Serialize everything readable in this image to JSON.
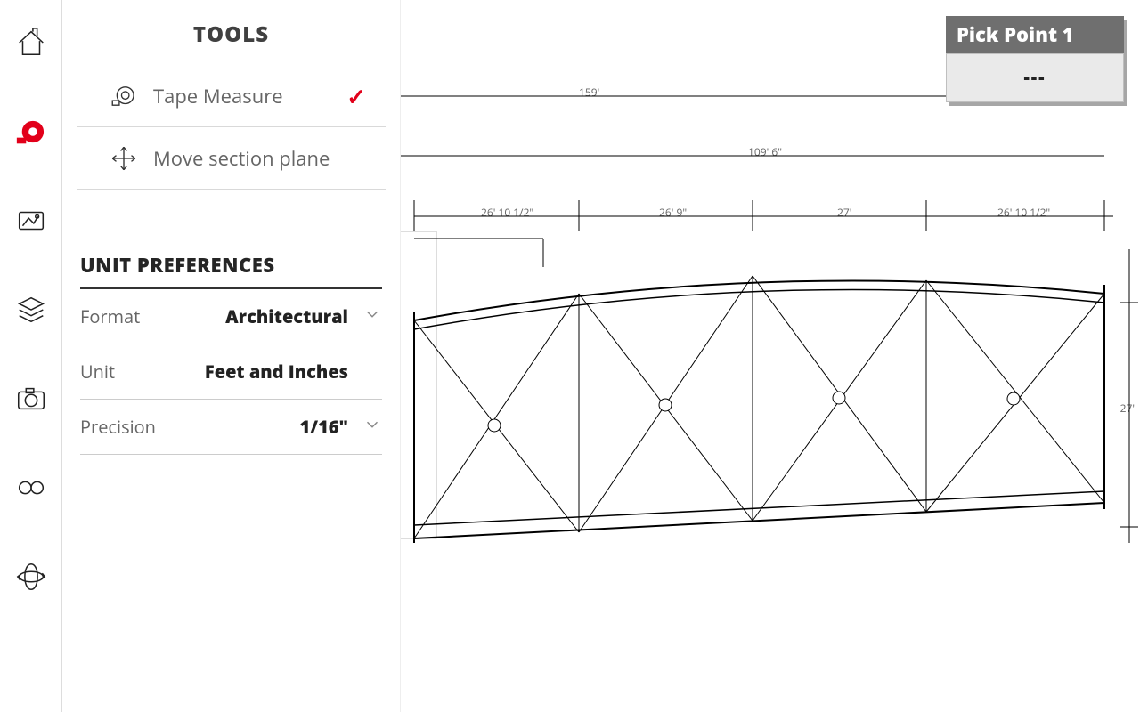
{
  "rail": {
    "items": [
      "home",
      "tape",
      "scene",
      "layers",
      "camera",
      "glasses",
      "orbit"
    ]
  },
  "panel": {
    "title": "TOOLS",
    "tools": [
      {
        "icon": "tape-measure-icon",
        "label": "Tape Measure",
        "selected": true
      },
      {
        "icon": "move-section-icon",
        "label": "Move section plane",
        "selected": false
      }
    ],
    "prefs": {
      "title": "UNIT PREFERENCES",
      "rows": [
        {
          "label": "Format",
          "value": "Architectural"
        },
        {
          "label": "Unit",
          "value": "Feet and Inches"
        },
        {
          "label": "Precision",
          "value": "1/16\""
        }
      ]
    }
  },
  "status": {
    "title": "Pick Point 1",
    "value": "---"
  },
  "dimensions": {
    "top_a": "159'",
    "top_b": "109' 6\"",
    "seg_1": "26' 10 1/2\"",
    "seg_2": "26' 9\"",
    "seg_3": "27'",
    "seg_4": "26' 10 1/2\"",
    "side": "27'"
  }
}
